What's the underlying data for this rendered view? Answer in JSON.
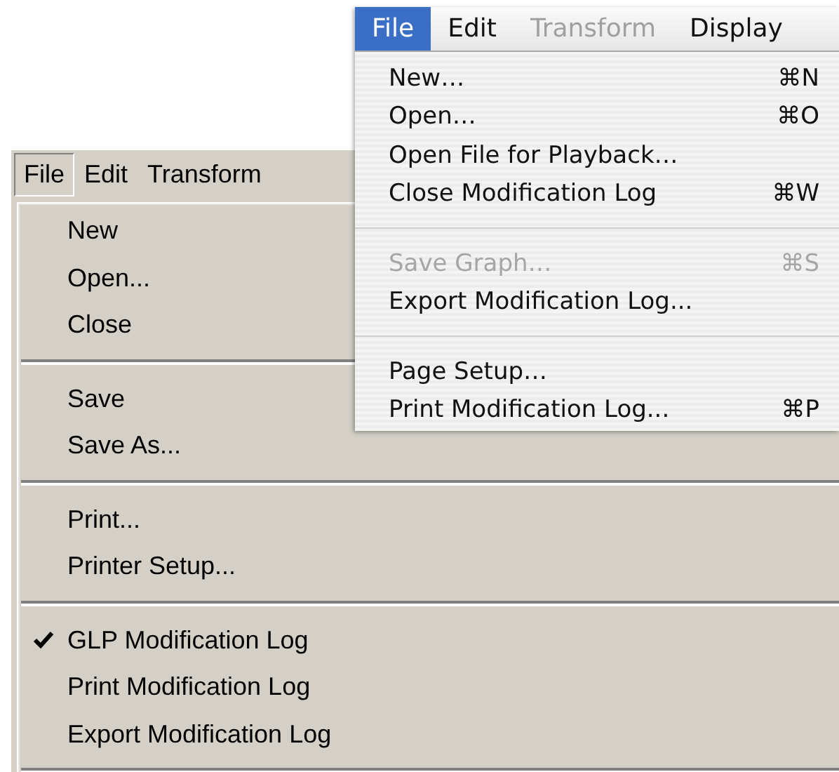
{
  "windows_menu": {
    "menubar": [
      {
        "label": "File",
        "selected": true
      },
      {
        "label": "Edit",
        "selected": false
      },
      {
        "label": "Transform",
        "selected": false
      }
    ],
    "items": [
      {
        "kind": "item",
        "label": "New",
        "checked": false
      },
      {
        "kind": "item",
        "label": "Open...",
        "checked": false
      },
      {
        "kind": "item",
        "label": "Close",
        "checked": false
      },
      {
        "kind": "separator"
      },
      {
        "kind": "item",
        "label": "Save",
        "checked": false
      },
      {
        "kind": "item",
        "label": "Save As...",
        "checked": false
      },
      {
        "kind": "separator"
      },
      {
        "kind": "item",
        "label": "Print...",
        "checked": false
      },
      {
        "kind": "item",
        "label": "Printer Setup...",
        "checked": false
      },
      {
        "kind": "separator"
      },
      {
        "kind": "item",
        "label": "GLP Modification Log",
        "checked": true
      },
      {
        "kind": "item",
        "label": "Print Modification Log",
        "checked": false
      },
      {
        "kind": "item",
        "label": "Export Modification Log",
        "checked": false
      },
      {
        "kind": "separator"
      }
    ]
  },
  "mac_menu": {
    "menubar": [
      {
        "label": "File",
        "selected": true,
        "disabled": false
      },
      {
        "label": "Edit",
        "selected": false,
        "disabled": false
      },
      {
        "label": "Transform",
        "selected": false,
        "disabled": true
      },
      {
        "label": "Display",
        "selected": false,
        "disabled": false
      }
    ],
    "items": [
      {
        "kind": "item",
        "label": "New…",
        "shortcut": "⌘N",
        "disabled": false
      },
      {
        "kind": "item",
        "label": "Open…",
        "shortcut": "⌘O",
        "disabled": false
      },
      {
        "kind": "item",
        "label": "Open File for Playback…",
        "disabled": false
      },
      {
        "kind": "item",
        "label": "Close Modification Log",
        "shortcut": "⌘W",
        "disabled": false
      },
      {
        "kind": "separator"
      },
      {
        "kind": "item",
        "label": "Save Graph…",
        "shortcut": "⌘S",
        "disabled": true
      },
      {
        "kind": "item",
        "label": "Export Modification Log...",
        "disabled": false
      },
      {
        "kind": "separator"
      },
      {
        "kind": "item",
        "label": "Page Setup…",
        "disabled": false
      },
      {
        "kind": "item",
        "label": "Print Modification Log...",
        "shortcut": "⌘P",
        "disabled": false
      }
    ]
  }
}
